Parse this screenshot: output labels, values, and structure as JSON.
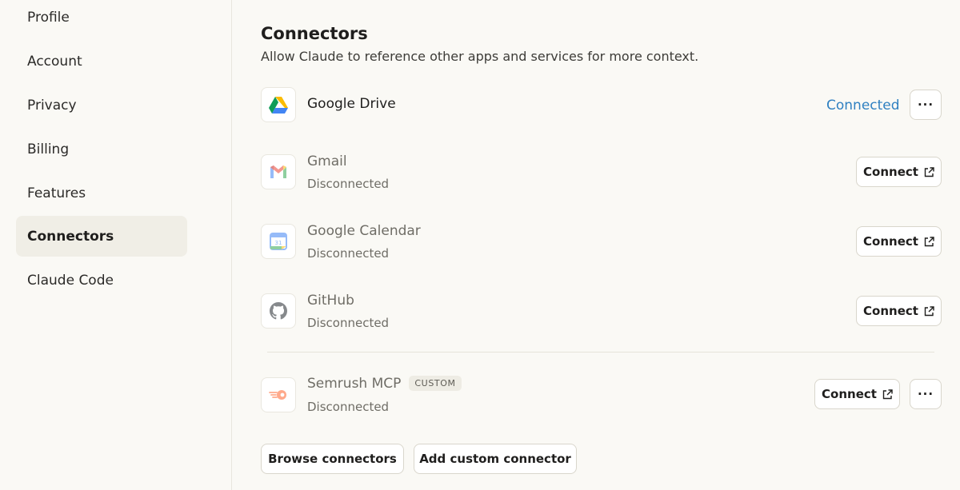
{
  "sidebar": {
    "items": [
      {
        "label": "Profile"
      },
      {
        "label": "Account"
      },
      {
        "label": "Privacy"
      },
      {
        "label": "Billing"
      },
      {
        "label": "Features"
      },
      {
        "label": "Connectors",
        "active": true
      },
      {
        "label": "Claude Code"
      }
    ]
  },
  "header": {
    "title": "Connectors",
    "subtitle": "Allow Claude to reference other apps and services for more context."
  },
  "connectors": [
    {
      "name": "Google Drive",
      "icon": "google-drive-icon",
      "status": "",
      "action": "Connected",
      "more": "···"
    },
    {
      "name": "Gmail",
      "icon": "gmail-icon",
      "status": "Disconnected",
      "action": "Connect"
    },
    {
      "name": "Google Calendar",
      "icon": "google-calendar-icon",
      "status": "Disconnected",
      "action": "Connect",
      "calendar_day": "31"
    },
    {
      "name": "GitHub",
      "icon": "github-icon",
      "status": "Disconnected",
      "action": "Connect"
    },
    {
      "name": "Semrush MCP",
      "icon": "semrush-icon",
      "badge": "CUSTOM",
      "status": "Disconnected",
      "action": "Connect",
      "more": "···"
    }
  ],
  "footer": {
    "browse_label": "Browse connectors",
    "add_label": "Add custom connector"
  },
  "colors": {
    "background": "#faf9f5",
    "active_nav": "#f0eee6",
    "connected_text": "#2f80c1",
    "border": "#d9d6cc"
  }
}
